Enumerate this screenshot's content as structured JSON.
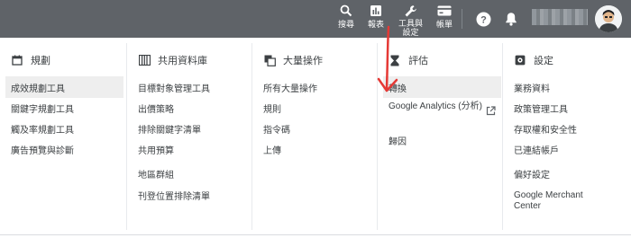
{
  "topbar": {
    "search": "搜尋",
    "reports": "報表",
    "tools_line1": "工具與",
    "tools_line2": "設定",
    "billing": "帳單"
  },
  "columns": [
    {
      "heading": "規劃",
      "icon": "calendar-icon",
      "items": [
        {
          "label": "成效規劃工具",
          "highlighted": true
        },
        {
          "label": "關鍵字規劃工具"
        },
        {
          "label": "觸及率規劃工具"
        },
        {
          "label": "廣告預覽與診斷"
        }
      ]
    },
    {
      "heading": "共用資料庫",
      "icon": "library-icon",
      "items": [
        {
          "label": "目標對象管理工具"
        },
        {
          "label": "出價策略"
        },
        {
          "label": "排除關鍵字清單"
        },
        {
          "label": "共用預算"
        },
        {
          "label": "地區群組"
        },
        {
          "label": "刊登位置排除清單"
        }
      ]
    },
    {
      "heading": "大量操作",
      "icon": "copy-icon",
      "items": [
        {
          "label": "所有大量操作"
        },
        {
          "label": "規則"
        },
        {
          "label": "指令碼"
        },
        {
          "label": "上傳"
        }
      ]
    },
    {
      "heading": "評估",
      "icon": "hourglass-icon",
      "items": [
        {
          "label": "轉換",
          "highlighted": true
        },
        {
          "label": "Google Analytics (分析)",
          "external": true
        },
        {
          "label": "歸因"
        }
      ]
    },
    {
      "heading": "設定",
      "icon": "settings-icon",
      "items": [
        {
          "label": "業務資料"
        },
        {
          "label": "政策管理工具"
        },
        {
          "label": "存取權和安全性"
        },
        {
          "label": "已連結帳戶"
        },
        {
          "label": "偏好設定"
        },
        {
          "label": "Google Merchant Center"
        }
      ]
    }
  ],
  "annotation": {
    "color": "#e53935",
    "shape": "red-arrow",
    "target": "轉換"
  }
}
